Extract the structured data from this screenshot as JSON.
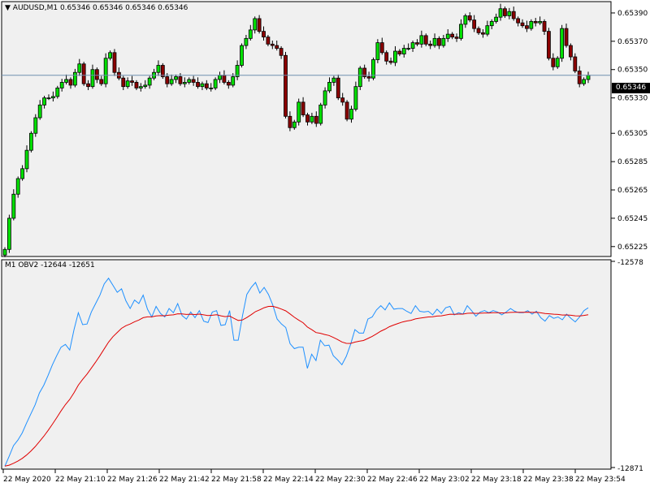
{
  "main_chart": {
    "symbol": "AUDUSD,M1",
    "ohlc": "0.65346 0.65346 0.65346 0.65346",
    "current_price": "0.65346",
    "y_ticks": [
      "0.65390",
      "0.65370",
      "0.65350",
      "0.65330",
      "0.65305",
      "0.65285",
      "0.65265",
      "0.65245",
      "0.65225"
    ]
  },
  "indicator": {
    "title": "M1 OBV2 -12644 -12651",
    "y_ticks": [
      "-12578",
      "-12871"
    ]
  },
  "x_axis": {
    "labels": [
      "22 May 2020",
      "22 May 21:10",
      "22 May 21:26",
      "22 May 21:42",
      "22 May 21:58",
      "22 May 22:14",
      "22 May 22:30",
      "22 May 22:46",
      "22 May 23:02",
      "22 May 23:18",
      "22 May 23:38",
      "22 May 23:54"
    ]
  },
  "colors": {
    "bull": "#00e000",
    "bear": "#8b0000",
    "outline": "#000000",
    "current_line": "#6f8fb0",
    "obv_line": "#1e90ff",
    "signal_line": "#e00000",
    "panel_bg": "#f0f0f0"
  },
  "chart_data": {
    "type": "candlestick",
    "closes": [
      0.65223,
      0.65245,
      0.65262,
      0.65273,
      0.6528,
      0.65293,
      0.65305,
      0.65316,
      0.65325,
      0.6533,
      0.6533,
      0.65331,
      0.65337,
      0.65341,
      0.65343,
      0.65339,
      0.65348,
      0.65354,
      0.6534,
      0.65338,
      0.6535,
      0.65343,
      0.6534,
      0.65358,
      0.65362,
      0.65348,
      0.65344,
      0.65338,
      0.65342,
      0.65341,
      0.65337,
      0.65338,
      0.65339,
      0.65344,
      0.65348,
      0.65353,
      0.65345,
      0.6534,
      0.65343,
      0.65345,
      0.6534,
      0.65341,
      0.65343,
      0.65341,
      0.65338,
      0.6534,
      0.65337,
      0.65337,
      0.65343,
      0.65346,
      0.65341,
      0.65339,
      0.65345,
      0.65353,
      0.65367,
      0.65372,
      0.65378,
      0.65386,
      0.65377,
      0.65373,
      0.65368,
      0.65367,
      0.65365,
      0.6536,
      0.65317,
      0.65309,
      0.65313,
      0.65327,
      0.65318,
      0.65313,
      0.65317,
      0.65312,
      0.65325,
      0.65335,
      0.65341,
      0.65344,
      0.6533,
      0.65327,
      0.65315,
      0.65322,
      0.65338,
      0.65351,
      0.65345,
      0.65344,
      0.65357,
      0.65369,
      0.65362,
      0.65356,
      0.65355,
      0.65363,
      0.65361,
      0.65365,
      0.65365,
      0.65369,
      0.65368,
      0.65374,
      0.65368,
      0.65367,
      0.65372,
      0.65367,
      0.65372,
      0.65375,
      0.65373,
      0.65372,
      0.65382,
      0.65388,
      0.65385,
      0.65379,
      0.65376,
      0.65375,
      0.65381,
      0.65384,
      0.65387,
      0.65393,
      0.65388,
      0.65391,
      0.65386,
      0.65383,
      0.65381,
      0.65379,
      0.65384,
      0.65383,
      0.65384,
      0.65377,
      0.65358,
      0.65352,
      0.65358,
      0.65379,
      0.65367,
      0.65359,
      0.65349,
      0.6534,
      0.65343,
      0.65346
    ],
    "value_range": [
      0.65218,
      0.65398
    ],
    "obv": [
      -12869,
      -12855,
      -12840,
      -12832,
      -12822,
      -12808,
      -12795,
      -12782,
      -12765,
      -12754,
      -12740,
      -12725,
      -12712,
      -12700,
      -12696,
      -12704,
      -12675,
      -12651,
      -12668,
      -12667,
      -12650,
      -12638,
      -12626,
      -12610,
      -12602,
      -12612,
      -12622,
      -12617,
      -12634,
      -12645,
      -12633,
      -12638,
      -12626,
      -12646,
      -12657,
      -12642,
      -12652,
      -12657,
      -12645,
      -12651,
      -12638,
      -12655,
      -12660,
      -12650,
      -12658,
      -12648,
      -12663,
      -12665,
      -12650,
      -12648,
      -12669,
      -12668,
      -12648,
      -12690,
      -12690,
      -12655,
      -12625,
      -12615,
      -12608,
      -12623,
      -12615,
      -12625,
      -12640,
      -12660,
      -12667,
      -12672,
      -12695,
      -12702,
      -12700,
      -12700,
      -12730,
      -12710,
      -12719,
      -12690,
      -12698,
      -12697,
      -12712,
      -12718,
      -12725,
      -12713,
      -12696,
      -12675,
      -12680,
      -12680,
      -12660,
      -12657,
      -12647,
      -12641,
      -12647,
      -12637,
      -12646,
      -12645,
      -12645,
      -12649,
      -12652,
      -12641,
      -12649,
      -12650,
      -12649,
      -12654,
      -12646,
      -12652,
      -12644,
      -12642,
      -12654,
      -12651,
      -12653,
      -12641,
      -12648,
      -12656,
      -12650,
      -12648,
      -12651,
      -12648,
      -12650,
      -12654,
      -12650,
      -12645,
      -12649,
      -12651,
      -12651,
      -12648,
      -12653,
      -12649,
      -12658,
      -12663,
      -12655,
      -12659,
      -12657,
      -12661,
      -12653,
      -12659,
      -12664,
      -12657,
      -12648,
      -12644
    ],
    "obv_range": [
      -12871,
      -12578
    ]
  }
}
